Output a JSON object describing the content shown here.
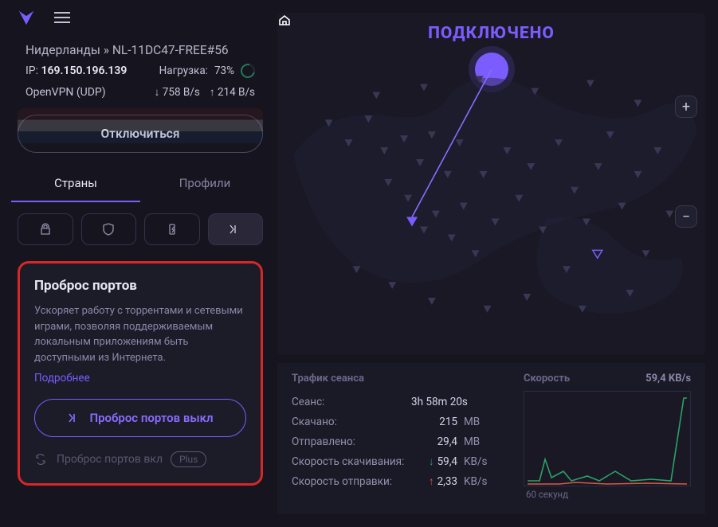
{
  "conn": {
    "breadcrumb": "Нидерланды » NL-11DC47-FREE#56",
    "ip_label": "IP:",
    "ip": "169.150.196.139",
    "load_label": "Нагрузка:",
    "load_value": "73%",
    "protocol": "OpenVPN (UDP)",
    "down": "758 B/s",
    "up": "214 B/s",
    "disconnect": "Отключиться"
  },
  "tabs": {
    "countries": "Страны",
    "profiles": "Профили"
  },
  "panel": {
    "title": "Проброс портов",
    "desc": "Ускоряет работу с торрентами и сетевыми играми, позволяя поддерживаемым локальным приложениям быть доступными из Интернета.",
    "more": "Подробнее",
    "off_btn": "Проброс портов выкл",
    "on_label": "Проброс портов вкл",
    "plus_badge": "Plus"
  },
  "main": {
    "status": "ПОДКЛЮЧЕНО"
  },
  "stats": {
    "traffic_header": "Трафик сеанса",
    "speed_header": "Скорость",
    "speed_max": "59,4 KB/s",
    "rows": {
      "session_k": "Сеанс:",
      "session_v": "3h 58m 20s",
      "downloaded_k": "Скачано:",
      "downloaded_v": "215",
      "downloaded_u": "MB",
      "uploaded_k": "Отправлено:",
      "uploaded_v": "29,4",
      "uploaded_u": "MB",
      "dlspeed_k": "Скорость скачивания:",
      "dlspeed_v": "59,4",
      "dlspeed_u": "KB/s",
      "ulspeed_k": "Скорость отправки:",
      "ulspeed_v": "2,33",
      "ulspeed_u": "KB/s"
    },
    "chart_x": "60 секунд"
  },
  "zoom": {
    "in": "+",
    "out": "−"
  },
  "win": {
    "min": "—",
    "max": "☐",
    "close": "✕"
  }
}
